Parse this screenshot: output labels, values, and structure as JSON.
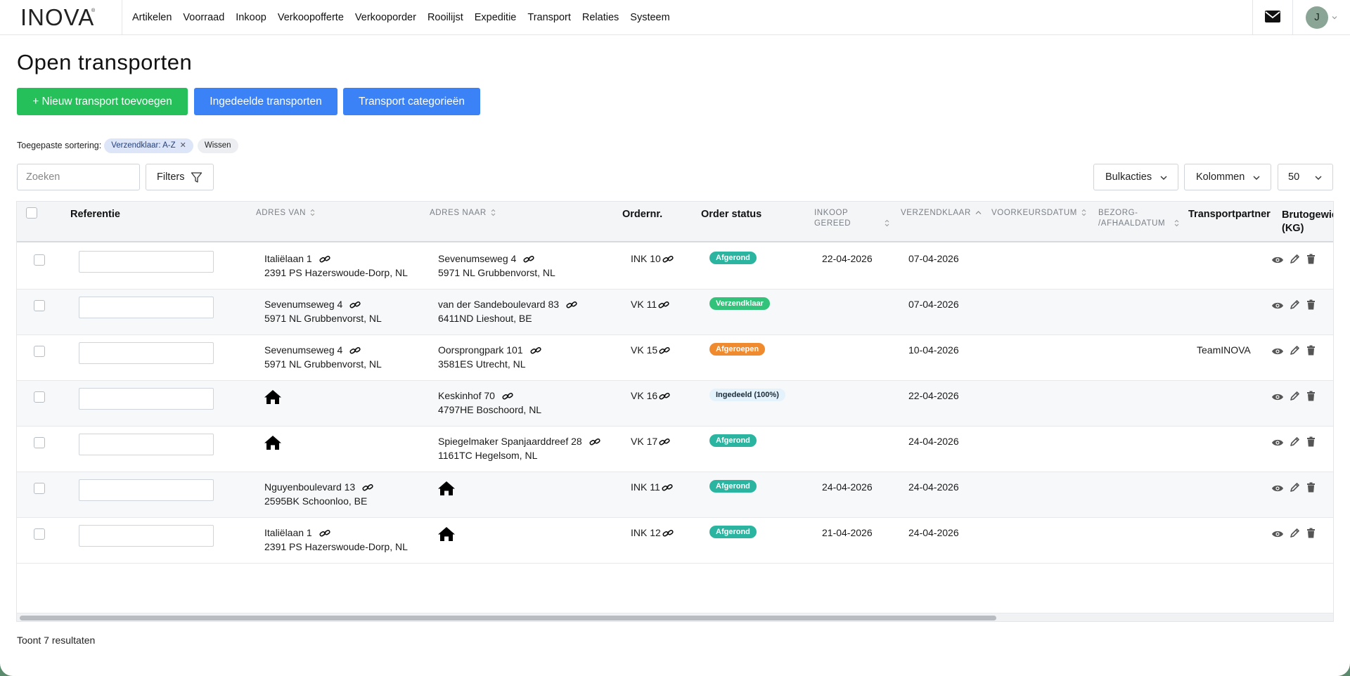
{
  "brand": {
    "logo_text": "INOVA",
    "logo_mark": "®"
  },
  "nav": {
    "items": [
      "Artikelen",
      "Voorraad",
      "Inkoop",
      "Verkoopofferte",
      "Verkooporder",
      "Rooilijst",
      "Expeditie",
      "Transport",
      "Relaties",
      "Systeem"
    ],
    "mail_icon": "envelope-icon",
    "avatar_initial": "J"
  },
  "page": {
    "title": "Open transporten",
    "buttons": {
      "add": "+ Nieuw transport toevoegen",
      "assigned": "Ingedeelde transporten",
      "categories": "Transport categorieën"
    },
    "colors": {
      "green": "#25c05a",
      "blue": "#3b82f6"
    }
  },
  "sorting": {
    "label": "Toegepaste sortering:",
    "chip": "Verzendklaar: A-Z",
    "clear": "Wissen"
  },
  "toolbar": {
    "search_placeholder": "Zoeken",
    "filters": "Filters",
    "bulk": "Bulkacties",
    "columns": "Kolommen",
    "page_size": "50"
  },
  "table": {
    "headers": {
      "referentie": "Referentie",
      "adres_van": "ADRES VAN",
      "adres_naar": "ADRES NAAR",
      "ordernr": "Ordernr.",
      "order_status": "Order status",
      "inkoop_gereed_1": "INKOOP",
      "inkoop_gereed_2": "GEREED",
      "verzendklaar": "VERZENDKLAAR",
      "voorkeursdatum": "VOORKEURSDATUM",
      "bezorg_1": "BEZORG-",
      "bezorg_2": "/AFHAALDATUM",
      "transportpartner": "Transportpartner",
      "brutogewicht_1": "Brutogewic",
      "brutogewicht_2": "(KG)"
    },
    "rows": [
      {
        "from1": "Italiëlaan 1",
        "from2": "2391 PS Hazerswoude-Dorp, NL",
        "to1": "Sevenumseweg 4",
        "to2": "5971 NL Grubbenvorst, NL",
        "order": "INK 10",
        "status": "Afgerond",
        "status_color": "#2bb5a0",
        "inkoop": "22-04-2026",
        "verzend": "07-04-2026",
        "partner": ""
      },
      {
        "from1": "Sevenumseweg 4",
        "from2": "5971 NL Grubbenvorst, NL",
        "to1": "van der Sandeboulevard 83",
        "to2": "6411ND Lieshout, BE",
        "order": "VK 11",
        "status": "Verzendklaar",
        "status_color": "#33c27a",
        "inkoop": "",
        "verzend": "07-04-2026",
        "partner": ""
      },
      {
        "from1": "Sevenumseweg 4",
        "from2": "5971 NL Grubbenvorst, NL",
        "to1": "Oorsprongpark 101",
        "to2": "3581ES Utrecht, NL",
        "order": "VK 15",
        "status": "Afgeroepen",
        "status_color": "#f08a2e",
        "inkoop": "",
        "verzend": "10-04-2026",
        "partner": "TeamINOVA"
      },
      {
        "from1": "",
        "from2": "",
        "from_home": true,
        "to1": "Keskinhof 70",
        "to2": "4797HE Boschoord, NL",
        "order": "VK 16",
        "status": "Ingedeeld (100%)",
        "status_color": "#e4f2fb",
        "inkoop": "",
        "verzend": "22-04-2026",
        "partner": ""
      },
      {
        "from1": "",
        "from2": "",
        "from_home": true,
        "to1": "Spiegelmaker Spanjaarddreef 28",
        "to2": "1161TC Hegelsom, NL",
        "order": "VK 17",
        "status": "Afgerond",
        "status_color": "#2bb5a0",
        "inkoop": "",
        "verzend": "24-04-2026",
        "partner": ""
      },
      {
        "from1": "Nguyenboulevard 13",
        "from2": "2595BK Schoonloo, BE",
        "to1": "",
        "to2": "",
        "to_home": true,
        "order": "INK 11",
        "status": "Afgerond",
        "status_color": "#2bb5a0",
        "inkoop": "24-04-2026",
        "verzend": "24-04-2026",
        "partner": ""
      },
      {
        "from1": "Italiëlaan 1",
        "from2": "2391 PS Hazerswoude-Dorp, NL",
        "to1": "",
        "to2": "",
        "to_home": true,
        "order": "INK 12",
        "status": "Afgerond",
        "status_color": "#2bb5a0",
        "inkoop": "21-04-2026",
        "verzend": "24-04-2026",
        "partner": ""
      }
    ]
  },
  "footer": {
    "result_count": "Toont 7 resultaten"
  }
}
